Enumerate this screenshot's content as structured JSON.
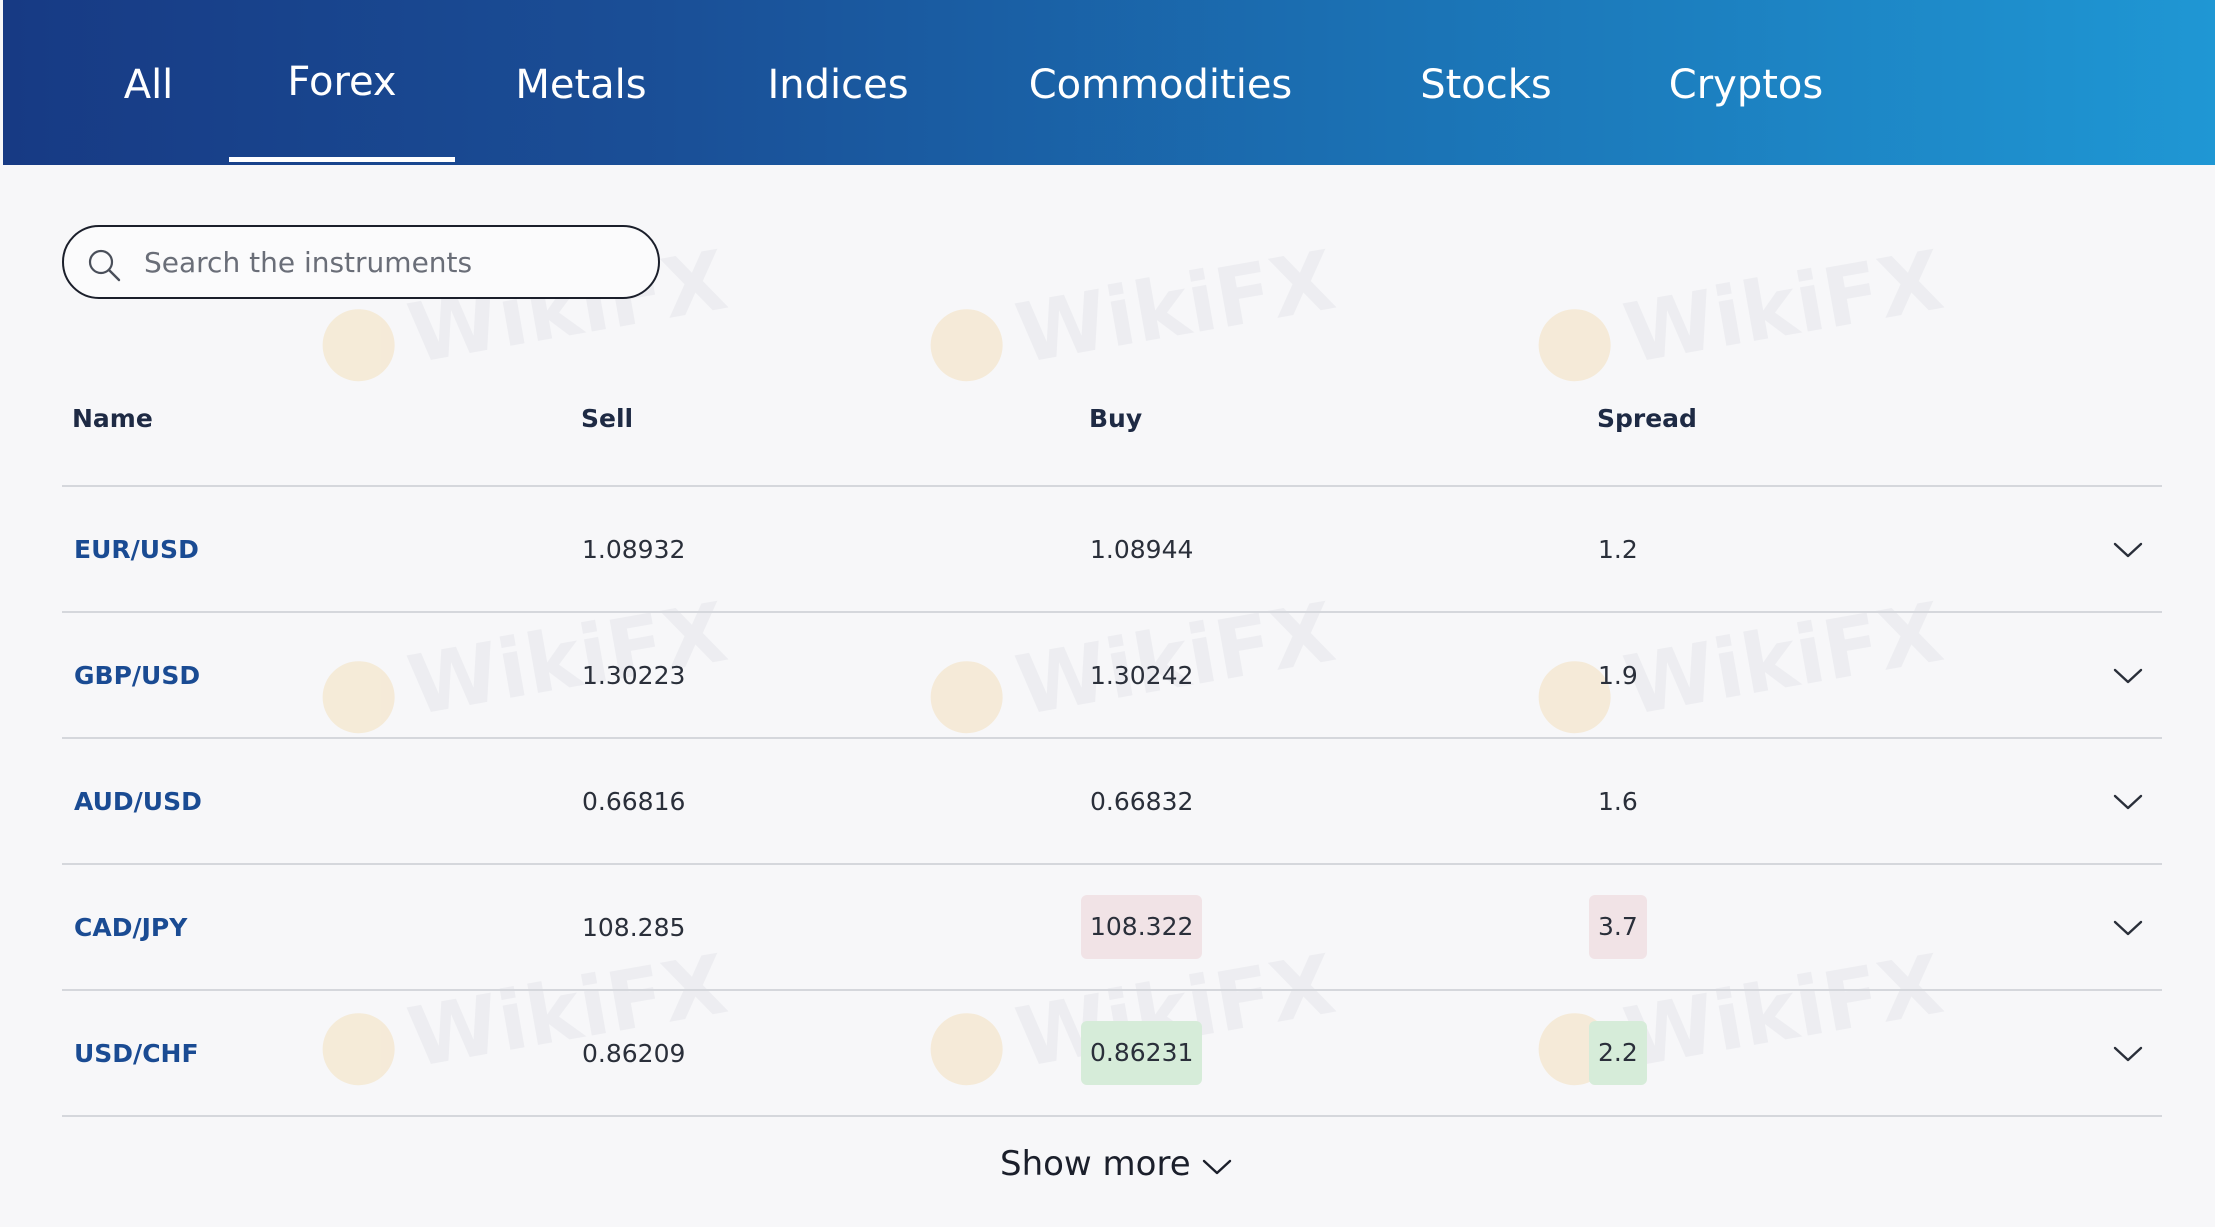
{
  "tabs": [
    {
      "label": "All",
      "active": false
    },
    {
      "label": "Forex",
      "active": true
    },
    {
      "label": "Metals",
      "active": false
    },
    {
      "label": "Indices",
      "active": false
    },
    {
      "label": "Commodities",
      "active": false
    },
    {
      "label": "Stocks",
      "active": false
    },
    {
      "label": "Cryptos",
      "active": false
    }
  ],
  "search": {
    "placeholder": "Search the instruments",
    "value": ""
  },
  "table": {
    "columns": [
      "Name",
      "Sell",
      "Buy",
      "Spread"
    ],
    "rows": [
      {
        "name": "EUR/USD",
        "sell": "1.08932",
        "buy": "1.08944",
        "spread": "1.2",
        "highlight": "none"
      },
      {
        "name": "GBP/USD",
        "sell": "1.30223",
        "buy": "1.30242",
        "spread": "1.9",
        "highlight": "none"
      },
      {
        "name": "AUD/USD",
        "sell": "0.66816",
        "buy": "0.66832",
        "spread": "1.6",
        "highlight": "none"
      },
      {
        "name": "CAD/JPY",
        "sell": "108.285",
        "buy": "108.322",
        "spread": "3.7",
        "highlight": "down"
      },
      {
        "name": "USD/CHF",
        "sell": "0.86209",
        "buy": "0.86231",
        "spread": "2.2",
        "highlight": "up"
      }
    ]
  },
  "show_more": "Show more",
  "watermark": {
    "text": "WikiFX"
  },
  "colors": {
    "tabbar_start": "#173a84",
    "tabbar_end": "#1f97d4",
    "name_link": "#1a4b93",
    "highlight_down": "#f1e3e6",
    "highlight_up": "#d6ecd9"
  }
}
